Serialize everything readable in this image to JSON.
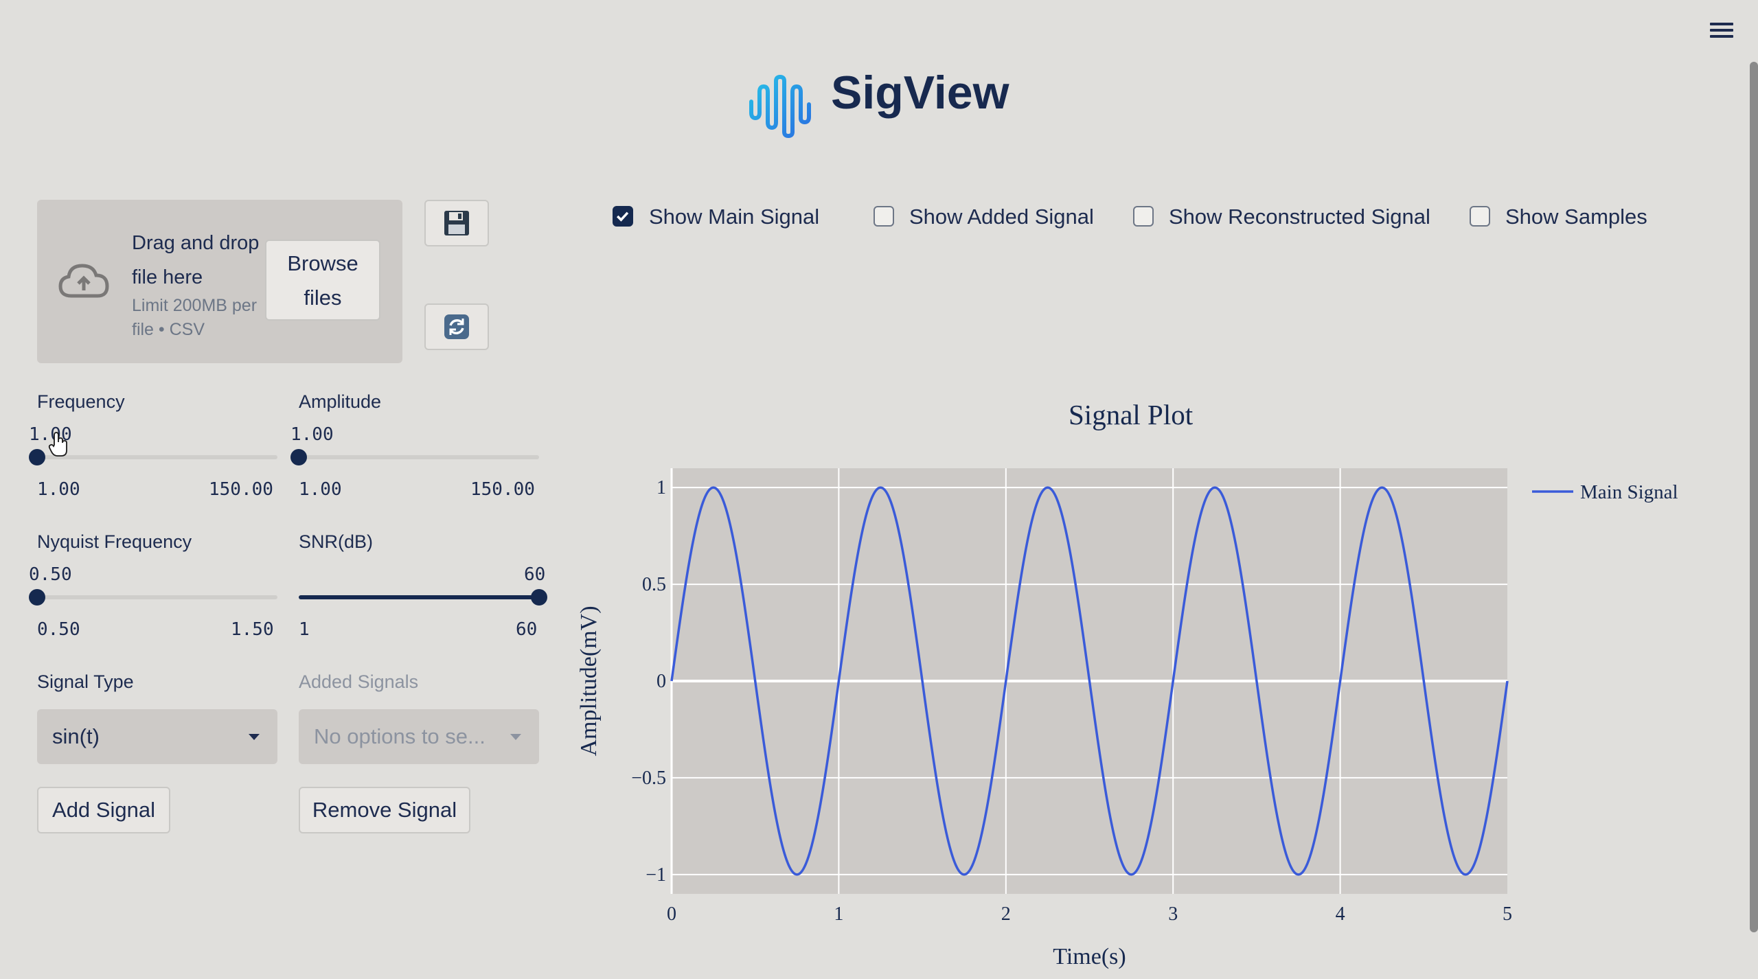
{
  "app": {
    "title": "SigView"
  },
  "uploader": {
    "drop_text": "Drag and drop file here",
    "limit_text": "Limit 200MB per file • CSV",
    "browse_label": "Browse files"
  },
  "sliders": {
    "frequency": {
      "label": "Frequency",
      "value": "1.00",
      "min": "1.00",
      "max": "150.00",
      "fraction": 0.0
    },
    "amplitude": {
      "label": "Amplitude",
      "value": "1.00",
      "min": "1.00",
      "max": "150.00",
      "fraction": 0.0
    },
    "nyquist": {
      "label": "Nyquist Frequency",
      "value": "0.50",
      "min": "0.50",
      "max": "1.50",
      "fraction": 0.0
    },
    "snr": {
      "label": "SNR(dB)",
      "value": "60",
      "min": "1",
      "max": "60",
      "fraction": 1.0
    }
  },
  "signal_type": {
    "label": "Signal Type",
    "value": "sin(t)"
  },
  "added_signals": {
    "label": "Added Signals",
    "placeholder": "No options to se..."
  },
  "buttons": {
    "add": "Add Signal",
    "remove": "Remove Signal"
  },
  "toggles": [
    {
      "label": "Show Main Signal",
      "checked": true
    },
    {
      "label": "Show Added Signal",
      "checked": false
    },
    {
      "label": "Show Reconstructed Signal",
      "checked": false
    },
    {
      "label": "Show Samples",
      "checked": false
    }
  ],
  "colors": {
    "accent": "#15294f",
    "series": "#3a5bd9",
    "plot_bg": "#cdcac7"
  },
  "chart_data": {
    "type": "line",
    "title": "Signal Plot",
    "xlabel": "Time(s)",
    "ylabel": "Amplitude(mV)",
    "xlim": [
      0,
      5
    ],
    "ylim": [
      -1.1,
      1.1
    ],
    "x_ticks": [
      "0",
      "1",
      "2",
      "3",
      "4",
      "5"
    ],
    "y_ticks": [
      "1",
      "0.5",
      "0",
      "−0.5",
      "−1"
    ],
    "y_tick_values": [
      1,
      0.5,
      0,
      -0.5,
      -1
    ],
    "legend_position": "right",
    "series": [
      {
        "name": "Main Signal",
        "function": "sin(2*pi*t)",
        "frequency_hz": 1,
        "amplitude_mv": 1
      }
    ]
  }
}
